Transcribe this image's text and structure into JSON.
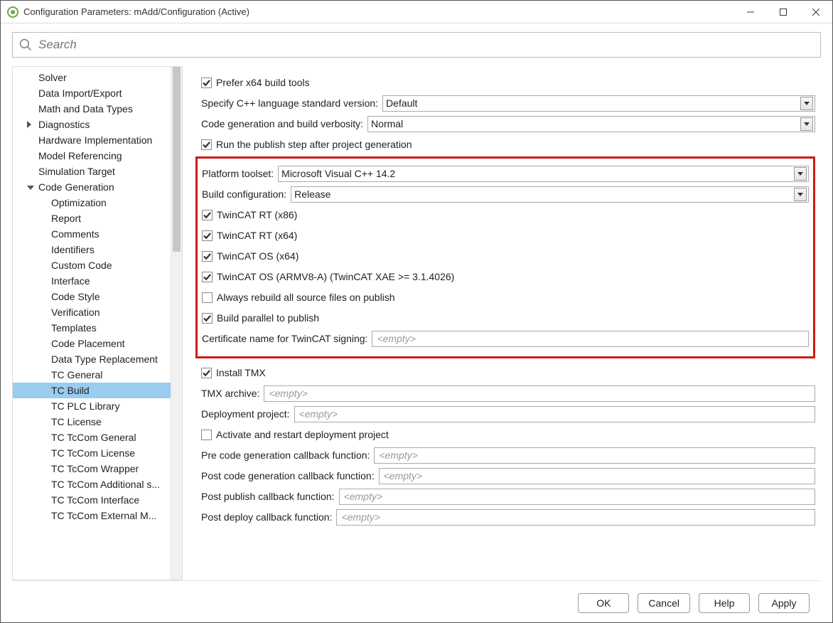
{
  "title": "Configuration Parameters: mAdd/Configuration (Active)",
  "search_placeholder": "Search",
  "sidebar": {
    "items": [
      {
        "label": "Solver"
      },
      {
        "label": "Data Import/Export"
      },
      {
        "label": "Math and Data Types"
      },
      {
        "label": "Diagnostics"
      },
      {
        "label": "Hardware Implementation"
      },
      {
        "label": "Model Referencing"
      },
      {
        "label": "Simulation Target"
      },
      {
        "label": "Code Generation"
      },
      {
        "label": "Optimization"
      },
      {
        "label": "Report"
      },
      {
        "label": "Comments"
      },
      {
        "label": "Identifiers"
      },
      {
        "label": "Custom Code"
      },
      {
        "label": "Interface"
      },
      {
        "label": "Code Style"
      },
      {
        "label": "Verification"
      },
      {
        "label": "Templates"
      },
      {
        "label": "Code Placement"
      },
      {
        "label": "Data Type Replacement"
      },
      {
        "label": "TC General"
      },
      {
        "label": "TC Build"
      },
      {
        "label": "TC PLC Library"
      },
      {
        "label": "TC License"
      },
      {
        "label": "TC TcCom General"
      },
      {
        "label": "TC TcCom License"
      },
      {
        "label": "TC TcCom Wrapper"
      },
      {
        "label": "TC TcCom Additional s..."
      },
      {
        "label": "TC TcCom Interface"
      },
      {
        "label": "TC TcCom External M..."
      }
    ]
  },
  "settings": {
    "prefer_x64": "Prefer x64 build tools",
    "cpp_std_label": "Specify C++ language standard version:",
    "cpp_std_value": "Default",
    "verbosity_label": "Code generation and build verbosity:",
    "verbosity_value": "Normal",
    "run_publish": "Run the publish step after project generation",
    "toolset_label": "Platform toolset:",
    "toolset_value": "Microsoft Visual C++ 14.2",
    "buildcfg_label": "Build configuration:",
    "buildcfg_value": "Release",
    "twincat_rt_x86": "TwinCAT RT (x86)",
    "twincat_rt_x64": "TwinCAT RT (x64)",
    "twincat_os_x64": "TwinCAT OS (x64)",
    "twincat_os_arm": "TwinCAT OS (ARMV8-A) (TwinCAT XAE >= 3.1.4026)",
    "always_rebuild": "Always rebuild all source files on publish",
    "build_parallel": "Build parallel to publish",
    "cert_label": "Certificate name for TwinCAT signing:",
    "install_tmx": "Install TMX",
    "tmx_archive_label": "TMX archive:",
    "deploy_proj_label": "Deployment project:",
    "activate_restart": "Activate and restart deployment project",
    "pre_gen_label": "Pre code generation callback function:",
    "post_gen_label": "Post code generation callback function:",
    "post_publish_label": "Post publish callback function:",
    "post_deploy_label": "Post deploy callback function:",
    "empty_placeholder": "<empty>"
  },
  "buttons": {
    "ok": "OK",
    "cancel": "Cancel",
    "help": "Help",
    "apply": "Apply"
  }
}
